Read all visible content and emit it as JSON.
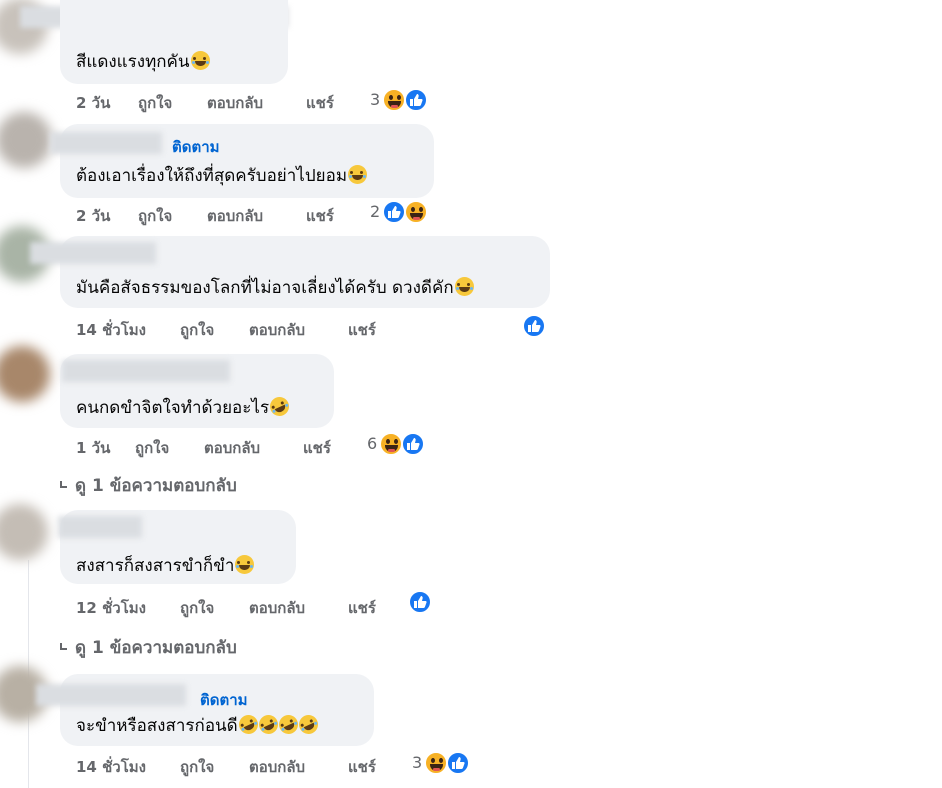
{
  "actions": {
    "like": "ถูกใจ",
    "reply": "ตอบกลับ",
    "share": "แชร์"
  },
  "comments": [
    {
      "text": "สีแดงแรงทุกคัน",
      "time": "2 วัน",
      "reaction_count": "3",
      "reactions": [
        "haha-icon",
        "like-icon"
      ]
    },
    {
      "follow": "ติดตาม",
      "text": "ต้องเอาเรื่องให้ถึงที่สุดครับอย่าไปยอม",
      "time": "2 วัน",
      "reaction_count": "2",
      "reactions": [
        "like-icon",
        "haha-icon"
      ]
    },
    {
      "text": "มันคือสัจธรรมของโลกที่ไม่อาจเลี่ยงได้ครับ ดวงดีคัก",
      "time": "14 ชั่วโมง",
      "reaction_count": "",
      "reactions": [
        "like-icon"
      ]
    },
    {
      "text": "คนกดขำจิตใจทำด้วยอะไร",
      "time": "1 วัน",
      "reaction_count": "6",
      "reactions": [
        "haha-icon",
        "like-icon"
      ],
      "view_replies": "ดู 1 ข้อความตอบกลับ"
    },
    {
      "text": "สงสารก็สงสารขำก็ขำ",
      "time": "12 ชั่วโมง",
      "reaction_count": "",
      "reactions": [
        "like-icon"
      ],
      "view_replies": "ดู 1 ข้อความตอบกลับ"
    },
    {
      "follow": "ติดตาม",
      "text": "จะขำหรือสงสารก่อนดี",
      "time": "14 ชั่วโมง",
      "reaction_count": "3",
      "reactions": [
        "haha-icon",
        "like-icon"
      ]
    }
  ],
  "colors": {
    "bubble": "#f0f2f5",
    "link": "#0064d1",
    "meta": "#65676b",
    "like": "#1877f2",
    "haha": "#f7b125"
  }
}
